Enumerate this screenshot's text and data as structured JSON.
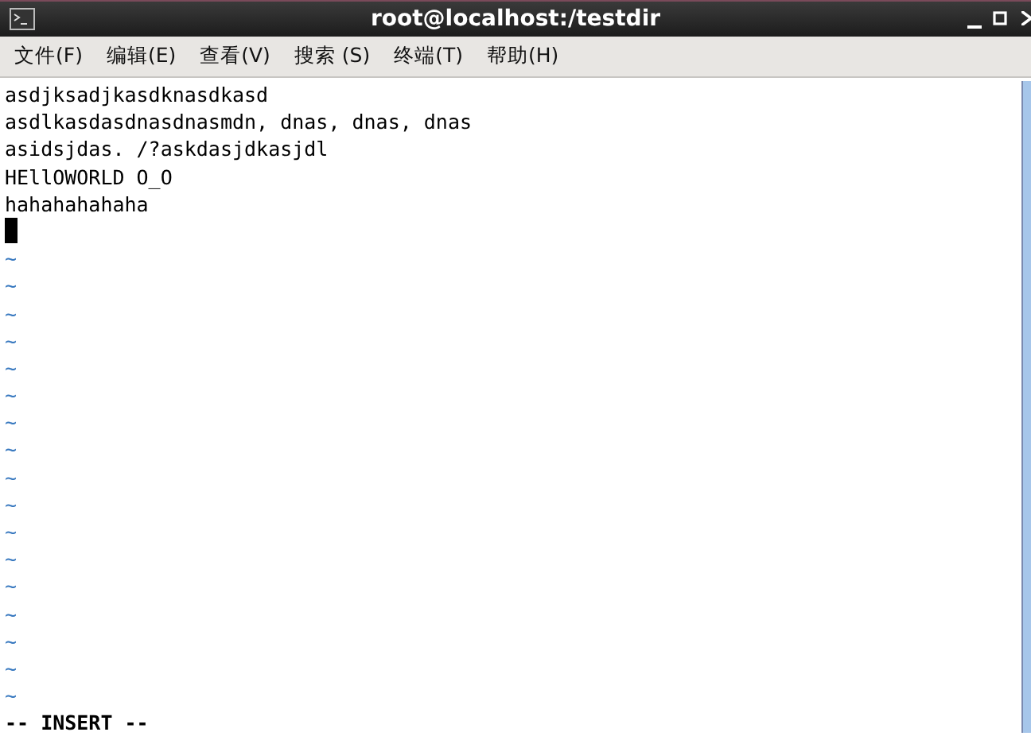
{
  "window": {
    "title": "root@localhost:/testdir"
  },
  "menu": [
    "文件(F)",
    "编辑(E)",
    "查看(V)",
    "搜索 (S)",
    "终端(T)",
    "帮助(H)"
  ],
  "buffer_lines": [
    "asdjksadjkasdknasdkasd",
    "asdlkasdasdnasdnasmdn, dnas, dnas, dnas",
    "asidsjdas. /?askdasjdkasjdl",
    "HEllOWORLD O_O",
    "hahahahahaha"
  ],
  "empty_lines": [
    "~",
    "~",
    "~",
    "~",
    "~",
    "~",
    "~",
    "~",
    "~",
    "~",
    "~",
    "~",
    "~",
    "~",
    "~",
    "~",
    "~"
  ],
  "status_line": "-- INSERT --"
}
